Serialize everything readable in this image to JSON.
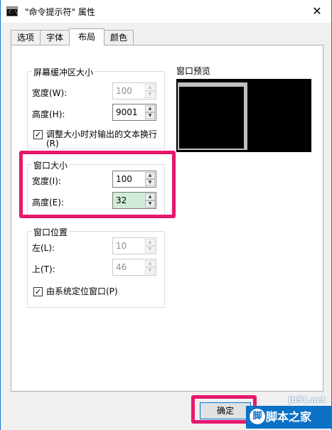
{
  "window": {
    "title": "\"命令提示符\" 属性",
    "icon_text": "C:\\",
    "close_glyph": "✕"
  },
  "tabs": [
    {
      "label": "选项",
      "active": false
    },
    {
      "label": "字体",
      "active": false
    },
    {
      "label": "布局",
      "active": true
    },
    {
      "label": "颜色",
      "active": false
    }
  ],
  "buffer_size": {
    "title": "屏幕缓冲区大小",
    "width_label": "宽度(W):",
    "width_value": "100",
    "height_label": "高度(H):",
    "height_value": "9001",
    "wrap_label_line1": "调整大小时对输出的文本换行",
    "wrap_label_line2": "(R)",
    "wrap_checked": "✓"
  },
  "window_size": {
    "title": "窗口大小",
    "width_label": "宽度(I):",
    "width_value": "100",
    "height_label": "高度(E):",
    "height_value": "32"
  },
  "window_position": {
    "title": "窗口位置",
    "left_label": "左(L):",
    "left_value": "10",
    "top_label": "上(T):",
    "top_value": "46",
    "system_label": "由系统定位窗口(P)",
    "system_checked": "✓"
  },
  "preview": {
    "title": "窗口预览"
  },
  "buttons": {
    "ok_label": "确定"
  },
  "spin_glyphs": {
    "up": "▲",
    "down": "▼"
  },
  "watermark": {
    "url": "jb51.net",
    "text": "脚本之家",
    "logo": "脚"
  },
  "colors": {
    "highlight": "#e8176c",
    "titlebar_border": "#1b73d8"
  }
}
